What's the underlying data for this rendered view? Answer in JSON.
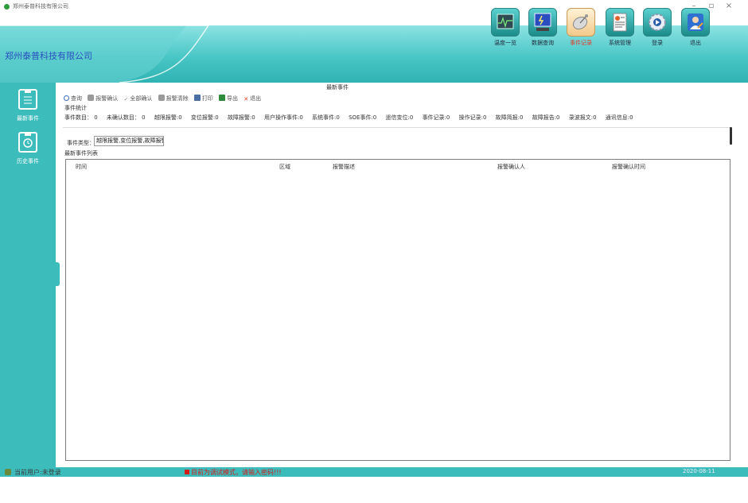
{
  "window": {
    "title": "郑州泰普科技有限公司",
    "minimize": "–",
    "maximize": "▫",
    "close": "×"
  },
  "header": {
    "company": "郑州泰普科技有限公司"
  },
  "nav": [
    {
      "label": "温度一览",
      "icon": "temperature-chart-icon",
      "active": false
    },
    {
      "label": "数据查询",
      "icon": "data-monitor-icon",
      "active": false
    },
    {
      "label": "事件记录",
      "icon": "event-satellite-icon",
      "active": true
    },
    {
      "label": "系统管理",
      "icon": "system-document-icon",
      "active": false
    },
    {
      "label": "登录",
      "icon": "login-gear-icon",
      "active": false
    },
    {
      "label": "退出",
      "icon": "logout-user-icon",
      "active": false
    }
  ],
  "sidebar": [
    {
      "label": "最新事件",
      "icon": "clipboard-list-icon"
    },
    {
      "label": "历史事件",
      "icon": "clipboard-clock-icon"
    }
  ],
  "page": {
    "title": "最新事件"
  },
  "toolbar": [
    {
      "label": "查询",
      "icon": "search-icon",
      "color": "#3b6fb6"
    },
    {
      "label": "报警确认",
      "icon": "user-confirm-icon",
      "color": "#8a8a8a"
    },
    {
      "label": "全部确认",
      "icon": "check-all-icon",
      "color": "#8a8a8a"
    },
    {
      "label": "报警清除",
      "icon": "user-clear-icon",
      "color": "#8a8a8a"
    },
    {
      "label": "打印",
      "icon": "printer-icon",
      "color": "#4a6fa5"
    },
    {
      "label": "导出",
      "icon": "export-icon",
      "color": "#2e8b3a"
    },
    {
      "label": "退出",
      "icon": "close-x-icon",
      "color": "#e03a1e"
    }
  ],
  "stats": {
    "label": "事件统计",
    "items": [
      "事件数目： 0",
      "未确认数目： 0",
      "越限报警:0",
      "变位报警:0",
      "故障报警:0",
      "用户操作事件:0",
      "系统事件:0",
      "SOE事件:0",
      "遥信变位:0",
      "事件记录:0",
      "操作记录:0",
      "故障简报:0",
      "故障报告:0",
      "录波报文:0",
      "通讯信息:0"
    ]
  },
  "filter": {
    "label": "事件类型：",
    "value": "越限报警,变位报警,故障报警"
  },
  "list": {
    "label": "最新事件列表",
    "columns": [
      "时间",
      "区域",
      "报警描述",
      "报警确认人",
      "报警确认时间"
    ]
  },
  "status": {
    "user": "当前用户:未登录",
    "warning": "目前为调试模式，请输入密码!!!",
    "date": "2020-08-11"
  }
}
